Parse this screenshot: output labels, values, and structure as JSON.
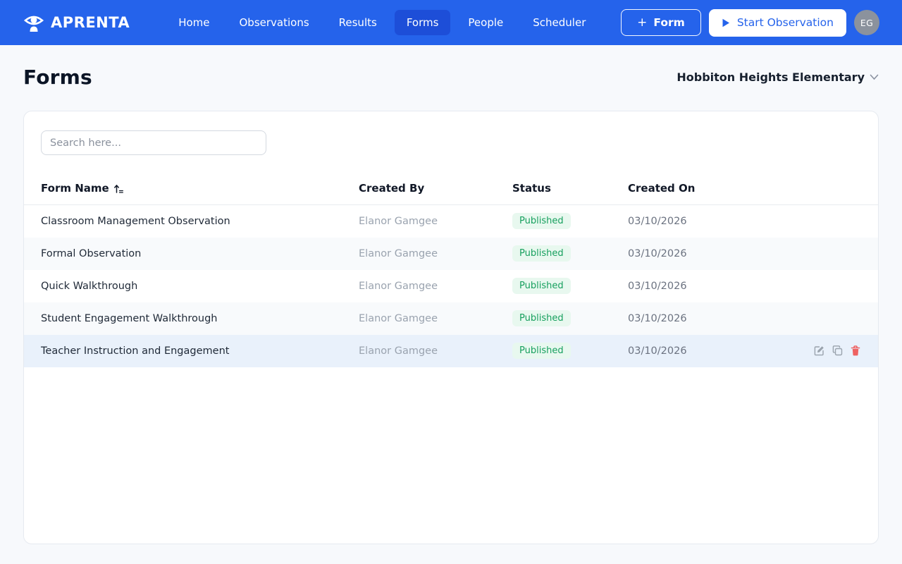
{
  "brand": {
    "name": "APRENTA"
  },
  "nav": {
    "items": [
      {
        "label": "Home",
        "active": false
      },
      {
        "label": "Observations",
        "active": false
      },
      {
        "label": "Results",
        "active": false
      },
      {
        "label": "Forms",
        "active": true
      },
      {
        "label": "People",
        "active": false
      },
      {
        "label": "Scheduler",
        "active": false
      }
    ]
  },
  "actions": {
    "form_button_icon": "+",
    "form_button_label": "Form",
    "start_observation_label": "Start Observation",
    "avatar_initials": "EG"
  },
  "page": {
    "title": "Forms",
    "school_selector": "Hobbiton Heights Elementary"
  },
  "search": {
    "placeholder": "Search here..."
  },
  "table": {
    "columns": {
      "name": "Form Name",
      "created_by": "Created By",
      "status": "Status",
      "created_on": "Created On"
    },
    "sort": {
      "column": "Form Name",
      "direction": "ascending"
    },
    "rows": [
      {
        "name": "Classroom Management Observation",
        "created_by": "Elanor Gamgee",
        "status": "Published",
        "created_on": "03/10/2026"
      },
      {
        "name": "Formal Observation",
        "created_by": "Elanor Gamgee",
        "status": "Published",
        "created_on": "03/10/2026"
      },
      {
        "name": "Quick Walkthrough",
        "created_by": "Elanor Gamgee",
        "status": "Published",
        "created_on": "03/10/2026"
      },
      {
        "name": "Student Engagement Walkthrough",
        "created_by": "Elanor Gamgee",
        "status": "Published",
        "created_on": "03/10/2026"
      },
      {
        "name": "Teacher Instruction and Engagement",
        "created_by": "Elanor Gamgee",
        "status": "Published",
        "created_on": "03/10/2026"
      }
    ],
    "row_actions": [
      "edit",
      "duplicate",
      "delete"
    ]
  },
  "colors": {
    "navbar": "#2563eb",
    "nav_active": "#1d4ed8",
    "badge_bg": "#e8f8ef",
    "badge_text": "#17a05e",
    "delete_icon": "#ee6161",
    "hover_row": "#e9f1fb"
  }
}
